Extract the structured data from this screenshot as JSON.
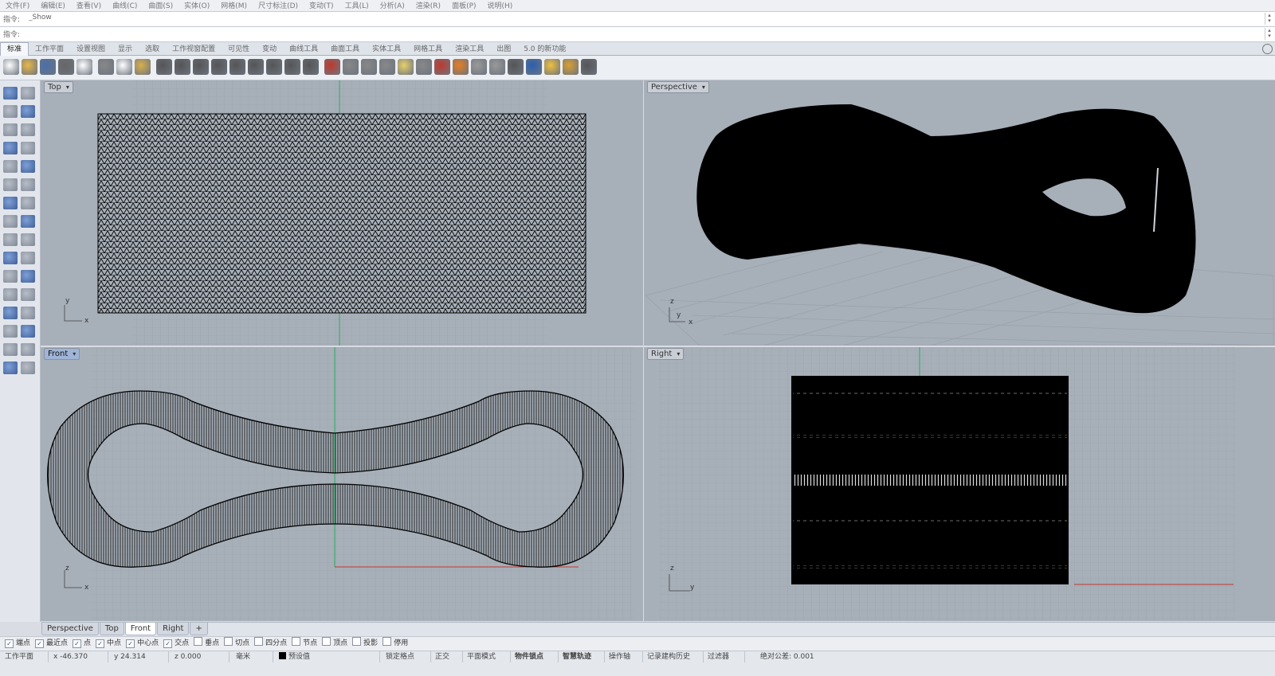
{
  "menu": [
    "文件(F)",
    "编辑(E)",
    "查看(V)",
    "曲线(C)",
    "曲面(S)",
    "实体(O)",
    "网格(M)",
    "尺寸标注(D)",
    "变动(T)",
    "工具(L)",
    "分析(A)",
    "渲染(R)",
    "面板(P)",
    "说明(H)"
  ],
  "command": {
    "history_label": "指令:",
    "history_value": "_Show",
    "prompt_label": "指令:"
  },
  "toolbar_tabs": [
    "标准",
    "工作平面",
    "设置视图",
    "显示",
    "选取",
    "工作视窗配置",
    "可见性",
    "变动",
    "曲线工具",
    "曲面工具",
    "实体工具",
    "网格工具",
    "渲染工具",
    "出图",
    "5.0 的新功能"
  ],
  "toolbar_icons": [
    "new-file-icon",
    "open-icon",
    "save-icon",
    "print-icon",
    "import-icon",
    "cut-icon",
    "copy-icon",
    "paste-icon",
    "undo-icon",
    "pan-hand-icon",
    "pan-arrows-icon",
    "zoom-icon",
    "zoom-window-icon",
    "zoom-extents-icon",
    "zoom-selected-icon",
    "rotate-view-icon",
    "four-views-icon",
    "car-icon",
    "visibility-icon",
    "camera-icon",
    "select-icon",
    "light-bulb-icon",
    "layer-icon",
    "properties-icon",
    "color-wheel-icon",
    "shade-icon",
    "render-icon",
    "render-sphere-icon",
    "flag-icon",
    "gear-icon",
    "options-icon",
    "help-icon"
  ],
  "viewports": {
    "top": {
      "title": "Top",
      "axis1": "y",
      "axis2": "x"
    },
    "perspective": {
      "title": "Perspective",
      "axis1": "z",
      "axis2": "y",
      "axis3": "x"
    },
    "front": {
      "title": "Front",
      "axis1": "z",
      "axis2": "x"
    },
    "right": {
      "title": "Right",
      "axis1": "z",
      "axis2": "y"
    }
  },
  "viewport_tabs": [
    "Perspective",
    "Top",
    "Front",
    "Right"
  ],
  "osnap": [
    {
      "label": "端点",
      "checked": true
    },
    {
      "label": "最近点",
      "checked": true
    },
    {
      "label": "点",
      "checked": true
    },
    {
      "label": "中点",
      "checked": true
    },
    {
      "label": "中心点",
      "checked": true
    },
    {
      "label": "交点",
      "checked": true
    },
    {
      "label": "垂点",
      "checked": false
    },
    {
      "label": "切点",
      "checked": false
    },
    {
      "label": "四分点",
      "checked": false
    },
    {
      "label": "节点",
      "checked": false
    },
    {
      "label": "顶点",
      "checked": false
    },
    {
      "label": "投影",
      "checked": false
    },
    {
      "label": "停用",
      "checked": false
    }
  ],
  "status": {
    "cplane": "工作平面",
    "x": "x -46.370",
    "y": "y 24.314",
    "z": "z 0.000",
    "units": "毫米",
    "layer": "预设值",
    "buttons": [
      "锁定格点",
      "正交",
      "平面模式",
      "物件锁点",
      "智慧轨迹",
      "操作轴",
      "记录建构历史",
      "过滤器"
    ],
    "tolerance": "绝对公差: 0.001"
  },
  "colors": {
    "viewport_bg": "#a7afb8",
    "active_title": "#9fb4d6",
    "x_axis": "#c0392b",
    "y_axis": "#27ae60"
  }
}
